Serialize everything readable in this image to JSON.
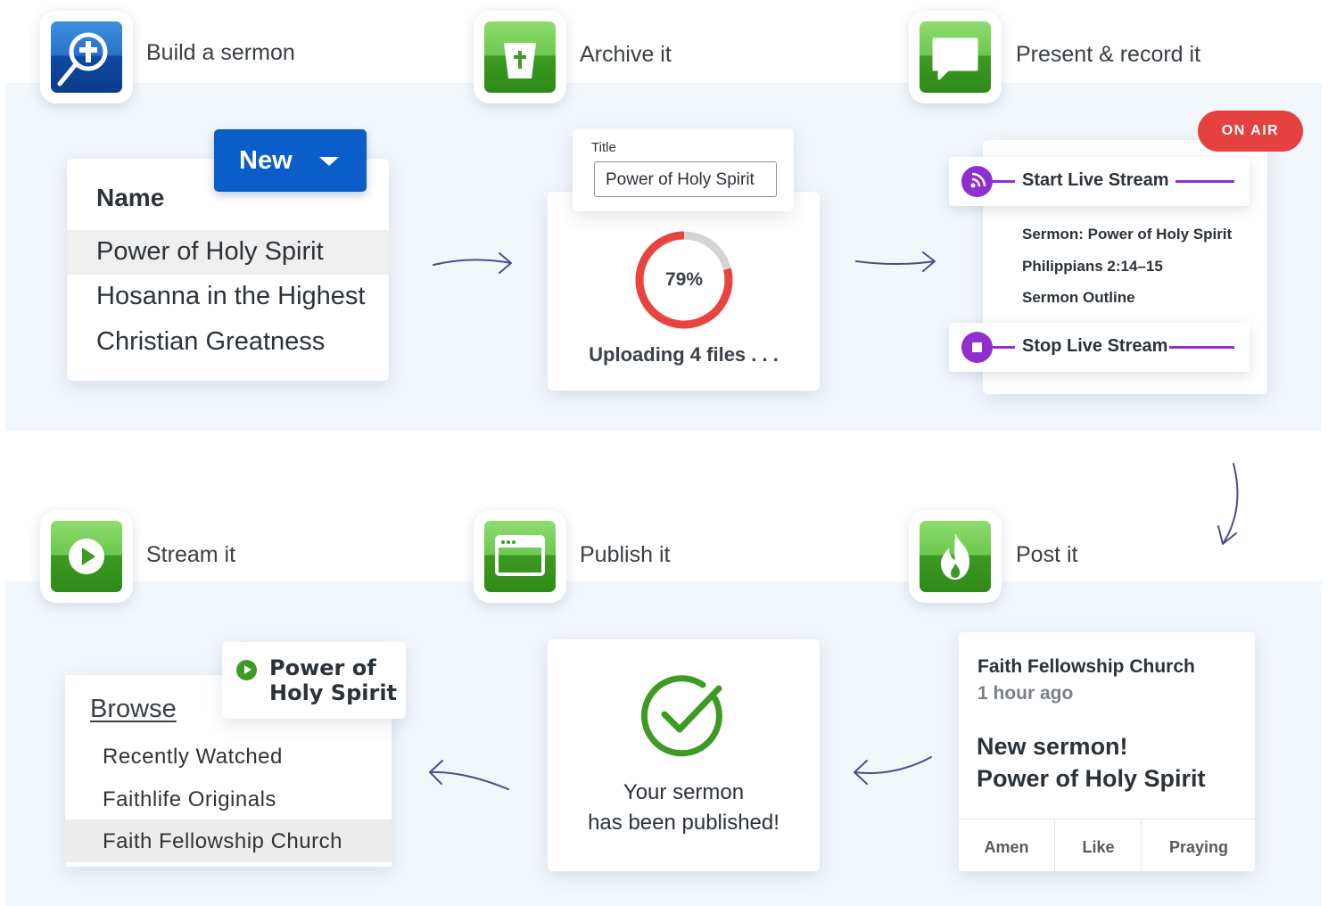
{
  "steps": {
    "build": "Build a sermon",
    "archive": "Archive it",
    "present": "Present & record it",
    "stream": "Stream it",
    "publish": "Publish it",
    "post": "Post it"
  },
  "build_card": {
    "new_button": "New",
    "header": "Name",
    "rows": [
      "Power of Holy Spirit",
      "Hosanna in the Highest",
      "Christian Greatness"
    ]
  },
  "archive_card": {
    "title_label": "Title",
    "title_value": "Power of Holy Spirit",
    "progress_percent": 79,
    "progress_label": "79%",
    "status": "Uploading 4 files . . ."
  },
  "present_card": {
    "on_air": "ON AIR",
    "start_stream": "Start Live Stream",
    "stop_stream": "Stop Live Stream",
    "items": [
      "Sermon: Power of Holy Spirit",
      "Philippians 2:14–15",
      "Sermon Outline"
    ]
  },
  "stream_card": {
    "now_playing_line1": "Power of",
    "now_playing_line2": "Holy Spirit",
    "header": "Browse",
    "items": [
      "Recently Watched",
      "Faithlife Originals",
      "Faith Fellowship Church"
    ]
  },
  "publish_card": {
    "line1": "Your sermon",
    "line2": "has been published!"
  },
  "post_card": {
    "org": "Faith Fellowship Church",
    "time": "1 hour ago",
    "line1": "New sermon!",
    "line2": "Power of Holy Spirit",
    "actions": [
      "Amen",
      "Like",
      "Praying"
    ]
  },
  "colors": {
    "band": "#f2f7fc",
    "accent_blue": "#0b5ec9",
    "progress_red": "#e8433f",
    "live_purple": "#8f2fcf",
    "on_air_red": "#e4413f",
    "success_green": "#3d9a22",
    "arrow": "#4a4f86"
  },
  "icons": {
    "build": "logos-bible-search-icon",
    "archive": "archive-cup-icon",
    "present": "chat-bubble-icon",
    "stream": "play-circle-icon",
    "publish": "browser-window-icon",
    "post": "faithlife-flame-icon"
  }
}
